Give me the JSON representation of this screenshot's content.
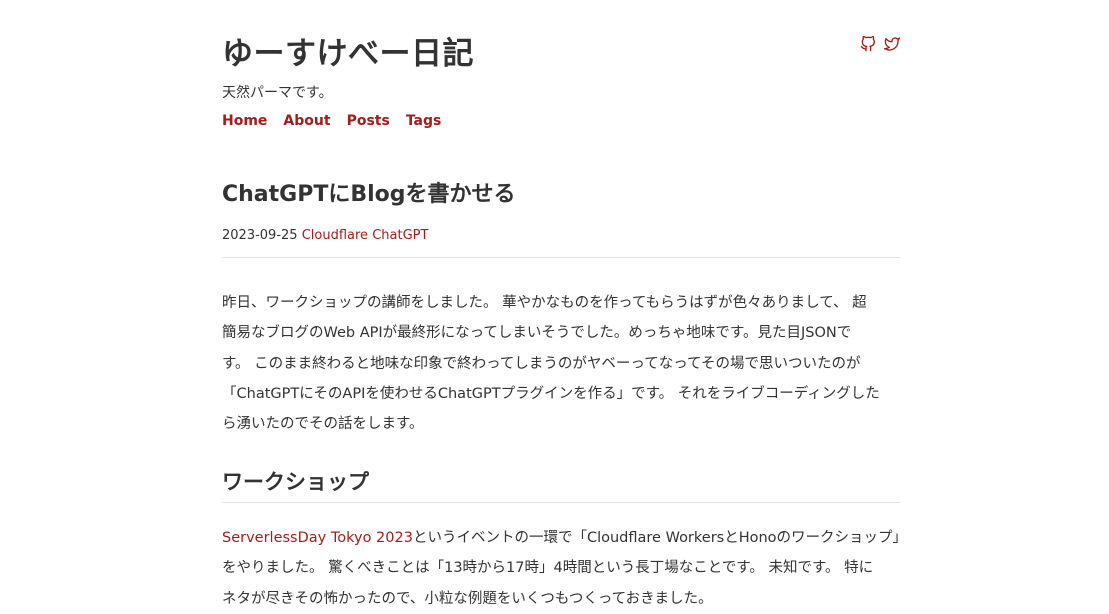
{
  "site": {
    "title": "ゆーすけべー日記",
    "tagline": "天然パーマです。"
  },
  "social": [
    {
      "icon": "github-icon"
    },
    {
      "icon": "twitter-icon"
    }
  ],
  "nav": {
    "items": [
      {
        "label": "Home"
      },
      {
        "label": "About"
      },
      {
        "label": "Posts"
      },
      {
        "label": "Tags"
      }
    ]
  },
  "post": {
    "title": "ChatGPTにBlogを書かせる",
    "date": "2023-09-25",
    "tags": [
      "Cloudflare",
      "ChatGPT"
    ],
    "intro_lines": [
      "昨日、ワークショップの講師をしました。 華やかなものを作ってもらうはずが色々ありまして、 超",
      "簡易なブログのWeb APIが最終形になってしまいそうでした。めっちゃ地味です。見た目JSONで",
      "す。 このまま終わると地味な印象で終わってしまうのがヤベーってなってその場で思いついたのが",
      "「ChatGPTにそのAPIを使わせるChatGPTプラグインを作る」です。 それをライブコーディングした",
      "ら湧いたのでその話をします。"
    ],
    "section": {
      "title": "ワークショップ",
      "link_text": "ServerlessDay Tokyo 2023",
      "line1_rest": "というイベントの一環で「Cloudflare WorkersとHonoのワークショップ」",
      "line2": "をやりました。 驚くべきことは「13時から17時」4時間という長丁場なことです。 未知です。 特に",
      "line3": "ネタが尽きその怖かったので、小粒な例題をいくつもつくっておきました。"
    }
  },
  "colors": {
    "accent": "#a51c1c",
    "text": "#333333",
    "rule": "#e6e6e6"
  }
}
